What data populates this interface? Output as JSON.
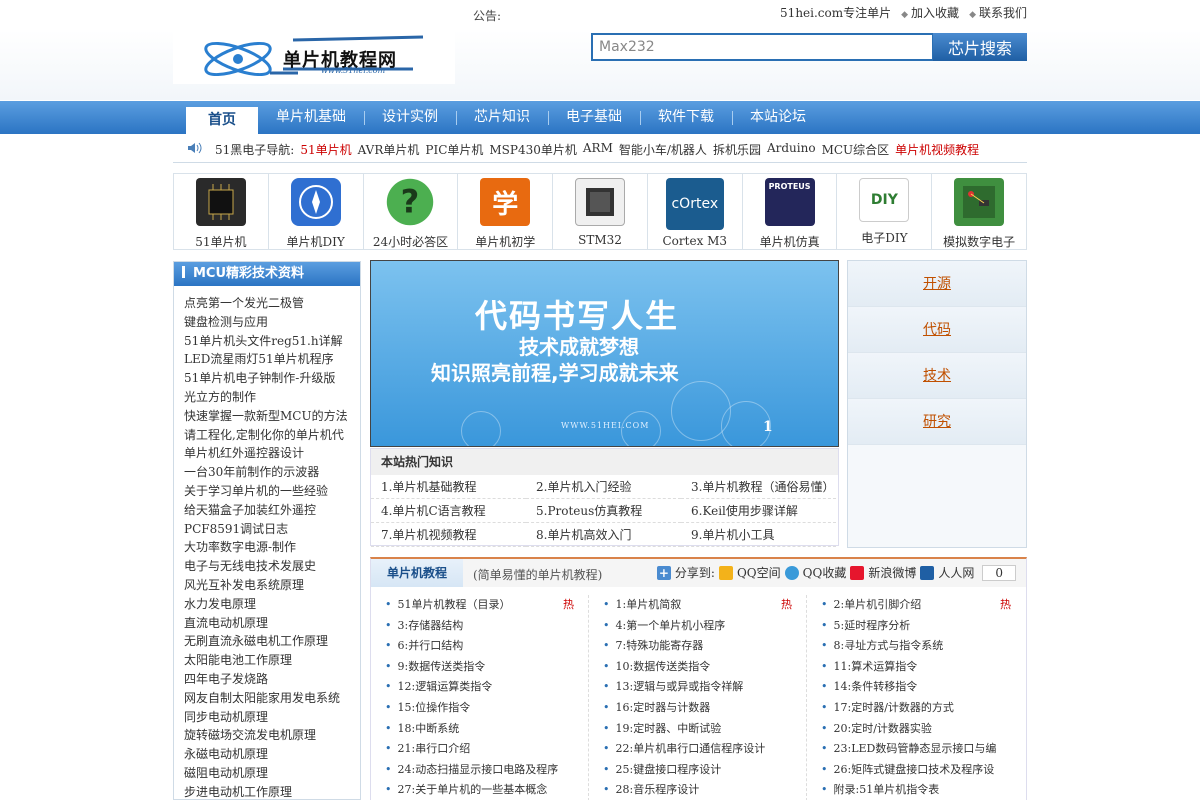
{
  "topbar": {
    "notice_label": "公告:",
    "links": [
      "51hei.com专注单片",
      "加入收藏",
      "联系我们"
    ]
  },
  "logo": {
    "title": "单片机教程网",
    "subtitle": "www.51hei.com"
  },
  "search": {
    "value": "Max232",
    "button": "芯片搜索"
  },
  "nav": {
    "items": [
      "首页",
      "单片机基础",
      "设计实例",
      "芯片知识",
      "电子基础",
      "软件下载",
      "本站论坛"
    ]
  },
  "subnav": {
    "label": "51黑电子导航:",
    "links": [
      {
        "text": "51单片机",
        "red": true
      },
      {
        "text": "AVR单片机"
      },
      {
        "text": "PIC单片机"
      },
      {
        "text": "MSP430单片机"
      },
      {
        "text": "ARM"
      },
      {
        "text": "智能小车/机器人"
      },
      {
        "text": "拆机乐园"
      },
      {
        "text": "Arduino"
      },
      {
        "text": "MCU综合区"
      },
      {
        "text": "单片机视频教程",
        "red": true
      }
    ]
  },
  "icons": [
    {
      "label": "51单片机",
      "icon": "chip-icon",
      "color": "#2a2a2a"
    },
    {
      "label": "单片机DIY",
      "icon": "compass-icon",
      "color": "#2f6fd1"
    },
    {
      "label": "24小时必答区",
      "icon": "question-icon",
      "color": "#2ca02c"
    },
    {
      "label": "单片机初学",
      "icon": "learn-icon",
      "color": "#e86a10",
      "glyph": "学"
    },
    {
      "label": "STM32",
      "icon": "stm32-chip-icon",
      "color": "#3a3a3a"
    },
    {
      "label": "Cortex M3",
      "icon": "cortex-icon",
      "color": "#1b5c8f",
      "glyph": "cOrtex"
    },
    {
      "label": "单片机仿真",
      "icon": "proteus-icon",
      "color": "#23265a",
      "glyph": "PROTEUS"
    },
    {
      "label": "电子DIY",
      "icon": "diy-icon",
      "color": "#7cb342",
      "glyph": "DIY"
    },
    {
      "label": "模拟数字电子",
      "icon": "circuit-board-icon",
      "color": "#3f8f3f"
    }
  ],
  "left": {
    "title": "MCU精彩技术资料",
    "items": [
      "点亮第一个发光二极管",
      "键盘检测与应用",
      "51单片机头文件reg51.h详解",
      "LED流星雨灯51单片机程序",
      "51单片机电子钟制作-升级版",
      "光立方的制作",
      "快速掌握一款新型MCU的方法",
      "请工程化,定制化你的单片机代",
      "单片机红外遥控器设计",
      "一台30年前制作的示波器",
      "关于学习单片机的一些经验",
      "给天猫盒子加装红外遥控",
      "PCF8591调试日志",
      "大功率数字电源-制作",
      "电子与无线电技术发展史",
      "风光互补发电系统原理",
      "水力发电原理",
      "直流电动机原理",
      "无刷直流永磁电机工作原理",
      "太阳能电池工作原理",
      "四年电子发烧路",
      "网友自制太阳能家用发电系统",
      "同步电动机原理",
      "旋转磁场交流发电机原理",
      "永磁电动机原理",
      "磁阻电动机原理",
      "步进电动机工作原理"
    ]
  },
  "banner": {
    "line1": "代码书写人生",
    "line2": "技术成就梦想",
    "line3": "知识照亮前程,学习成就未来",
    "site": "WWW.51HEI.COM",
    "slide": "1"
  },
  "hot": {
    "title": "本站热门知识",
    "items": [
      "1.单片机基础教程",
      "2.单片机入门经验",
      "3.单片机教程（通俗易懂）",
      "4.单片机C语言教程",
      "5.Proteus仿真教程",
      "6.Keil使用步骤详解",
      "7.单片机视频教程",
      "8.单片机高效入门",
      "9.单片机小工具"
    ]
  },
  "right": {
    "buttons": [
      "开源",
      "代码",
      "技术",
      "研究"
    ]
  },
  "section": {
    "title": "单片机教程",
    "desc": "(简单易懂的单片机教程)",
    "share": {
      "label": "分享到:",
      "targets": [
        "QQ空间",
        "QQ收藏",
        "新浪微博",
        "人人网"
      ],
      "count": "0"
    },
    "hot_mark": "热",
    "col1": [
      "51单片机教程（目录）",
      "3:存储器结构",
      "6:并行口结构",
      "9:数据传送类指令",
      "12:逻辑运算类指令",
      "15:位操作指令",
      "18:中断系统",
      "21:串行口介绍",
      "24:动态扫描显示接口电路及程序",
      "27:关于单片机的一些基本概念"
    ],
    "col2": [
      "1:单片机简叙",
      "4:第一个单片机小程序",
      "7:特殊功能寄存器",
      "10:数据传送类指令",
      "13:逻辑与或异或指令祥解",
      "16:定时器与计数器",
      "19:定时器、中断试验",
      "22:单片机串行口通信程序设计",
      "25:键盘接口程序设计",
      "28:音乐程序设计"
    ],
    "col3": [
      "2:单片机引脚介绍",
      "5:延时程序分析",
      "8:寻址方式与指令系统",
      "11:算术运算指令",
      "14:条件转移指令",
      "17:定时器/计数器的方式",
      "20:定时/计数器实验",
      "23:LED数码管静态显示接口与编",
      "26:矩阵式键盘接口技术及程序设",
      "附录:51单片机指令表"
    ]
  }
}
